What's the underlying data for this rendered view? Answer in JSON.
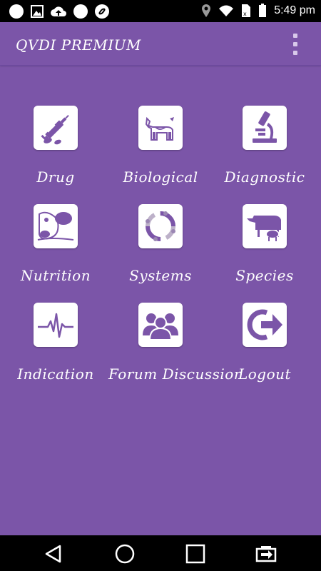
{
  "status_bar": {
    "time": "5:49 pm",
    "left_icons": [
      "notification-dot-icon",
      "image-icon",
      "cloud-upload-icon",
      "notification-dot-icon",
      "sync-icon"
    ],
    "right_icons": [
      "location-icon",
      "wifi-icon",
      "sim-icon",
      "battery-icon"
    ]
  },
  "app_bar": {
    "title": "QVDI PREMIUM",
    "menu_icon": "overflow-menu-icon"
  },
  "menu": {
    "items": [
      {
        "label": "Drug",
        "icon": "syringe-icon"
      },
      {
        "label": "Biological",
        "icon": "cow-icon"
      },
      {
        "label": "Diagnostic",
        "icon": "microscope-icon"
      },
      {
        "label": "Nutrition",
        "icon": "cow-eating-icon"
      },
      {
        "label": "Systems",
        "icon": "systems-cycle-icon"
      },
      {
        "label": "Species",
        "icon": "animals-icon"
      },
      {
        "label": "Indication",
        "icon": "heartbeat-icon"
      },
      {
        "label": "Forum Discussion",
        "icon": "group-users-icon"
      },
      {
        "label": "Logout",
        "icon": "logout-arrow-icon"
      }
    ]
  },
  "nav_bar": {
    "buttons": [
      "back-icon",
      "home-icon",
      "recents-icon",
      "screen-switch-icon"
    ]
  },
  "colors": {
    "background": "#7b55a8",
    "icon_purple": "#7b55a8",
    "status_bar": "#000000"
  }
}
